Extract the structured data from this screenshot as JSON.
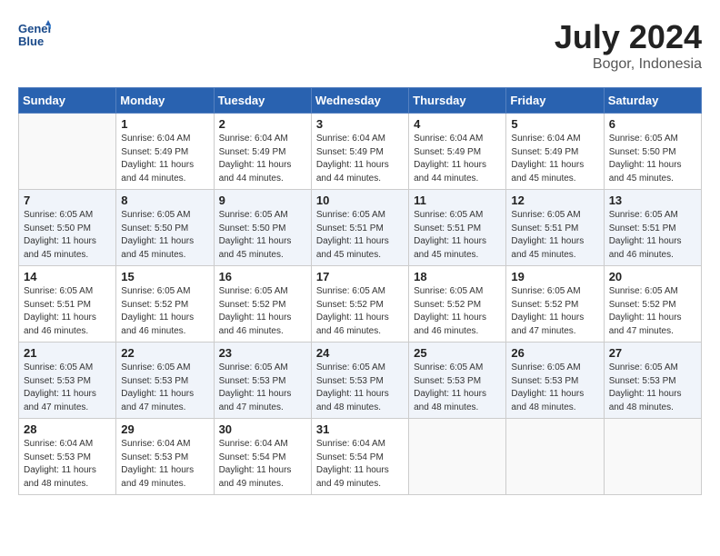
{
  "header": {
    "logo_line1": "General",
    "logo_line2": "Blue",
    "month": "July 2024",
    "location": "Bogor, Indonesia"
  },
  "columns": [
    "Sunday",
    "Monday",
    "Tuesday",
    "Wednesday",
    "Thursday",
    "Friday",
    "Saturday"
  ],
  "weeks": [
    [
      {
        "day": "",
        "info": ""
      },
      {
        "day": "1",
        "info": "Sunrise: 6:04 AM\nSunset: 5:49 PM\nDaylight: 11 hours\nand 44 minutes."
      },
      {
        "day": "2",
        "info": "Sunrise: 6:04 AM\nSunset: 5:49 PM\nDaylight: 11 hours\nand 44 minutes."
      },
      {
        "day": "3",
        "info": "Sunrise: 6:04 AM\nSunset: 5:49 PM\nDaylight: 11 hours\nand 44 minutes."
      },
      {
        "day": "4",
        "info": "Sunrise: 6:04 AM\nSunset: 5:49 PM\nDaylight: 11 hours\nand 44 minutes."
      },
      {
        "day": "5",
        "info": "Sunrise: 6:04 AM\nSunset: 5:49 PM\nDaylight: 11 hours\nand 45 minutes."
      },
      {
        "day": "6",
        "info": "Sunrise: 6:05 AM\nSunset: 5:50 PM\nDaylight: 11 hours\nand 45 minutes."
      }
    ],
    [
      {
        "day": "7",
        "info": "Sunrise: 6:05 AM\nSunset: 5:50 PM\nDaylight: 11 hours\nand 45 minutes."
      },
      {
        "day": "8",
        "info": "Sunrise: 6:05 AM\nSunset: 5:50 PM\nDaylight: 11 hours\nand 45 minutes."
      },
      {
        "day": "9",
        "info": "Sunrise: 6:05 AM\nSunset: 5:50 PM\nDaylight: 11 hours\nand 45 minutes."
      },
      {
        "day": "10",
        "info": "Sunrise: 6:05 AM\nSunset: 5:51 PM\nDaylight: 11 hours\nand 45 minutes."
      },
      {
        "day": "11",
        "info": "Sunrise: 6:05 AM\nSunset: 5:51 PM\nDaylight: 11 hours\nand 45 minutes."
      },
      {
        "day": "12",
        "info": "Sunrise: 6:05 AM\nSunset: 5:51 PM\nDaylight: 11 hours\nand 45 minutes."
      },
      {
        "day": "13",
        "info": "Sunrise: 6:05 AM\nSunset: 5:51 PM\nDaylight: 11 hours\nand 46 minutes."
      }
    ],
    [
      {
        "day": "14",
        "info": "Sunrise: 6:05 AM\nSunset: 5:51 PM\nDaylight: 11 hours\nand 46 minutes."
      },
      {
        "day": "15",
        "info": "Sunrise: 6:05 AM\nSunset: 5:52 PM\nDaylight: 11 hours\nand 46 minutes."
      },
      {
        "day": "16",
        "info": "Sunrise: 6:05 AM\nSunset: 5:52 PM\nDaylight: 11 hours\nand 46 minutes."
      },
      {
        "day": "17",
        "info": "Sunrise: 6:05 AM\nSunset: 5:52 PM\nDaylight: 11 hours\nand 46 minutes."
      },
      {
        "day": "18",
        "info": "Sunrise: 6:05 AM\nSunset: 5:52 PM\nDaylight: 11 hours\nand 46 minutes."
      },
      {
        "day": "19",
        "info": "Sunrise: 6:05 AM\nSunset: 5:52 PM\nDaylight: 11 hours\nand 47 minutes."
      },
      {
        "day": "20",
        "info": "Sunrise: 6:05 AM\nSunset: 5:52 PM\nDaylight: 11 hours\nand 47 minutes."
      }
    ],
    [
      {
        "day": "21",
        "info": "Sunrise: 6:05 AM\nSunset: 5:53 PM\nDaylight: 11 hours\nand 47 minutes."
      },
      {
        "day": "22",
        "info": "Sunrise: 6:05 AM\nSunset: 5:53 PM\nDaylight: 11 hours\nand 47 minutes."
      },
      {
        "day": "23",
        "info": "Sunrise: 6:05 AM\nSunset: 5:53 PM\nDaylight: 11 hours\nand 47 minutes."
      },
      {
        "day": "24",
        "info": "Sunrise: 6:05 AM\nSunset: 5:53 PM\nDaylight: 11 hours\nand 48 minutes."
      },
      {
        "day": "25",
        "info": "Sunrise: 6:05 AM\nSunset: 5:53 PM\nDaylight: 11 hours\nand 48 minutes."
      },
      {
        "day": "26",
        "info": "Sunrise: 6:05 AM\nSunset: 5:53 PM\nDaylight: 11 hours\nand 48 minutes."
      },
      {
        "day": "27",
        "info": "Sunrise: 6:05 AM\nSunset: 5:53 PM\nDaylight: 11 hours\nand 48 minutes."
      }
    ],
    [
      {
        "day": "28",
        "info": "Sunrise: 6:04 AM\nSunset: 5:53 PM\nDaylight: 11 hours\nand 48 minutes."
      },
      {
        "day": "29",
        "info": "Sunrise: 6:04 AM\nSunset: 5:53 PM\nDaylight: 11 hours\nand 49 minutes."
      },
      {
        "day": "30",
        "info": "Sunrise: 6:04 AM\nSunset: 5:54 PM\nDaylight: 11 hours\nand 49 minutes."
      },
      {
        "day": "31",
        "info": "Sunrise: 6:04 AM\nSunset: 5:54 PM\nDaylight: 11 hours\nand 49 minutes."
      },
      {
        "day": "",
        "info": ""
      },
      {
        "day": "",
        "info": ""
      },
      {
        "day": "",
        "info": ""
      }
    ]
  ]
}
